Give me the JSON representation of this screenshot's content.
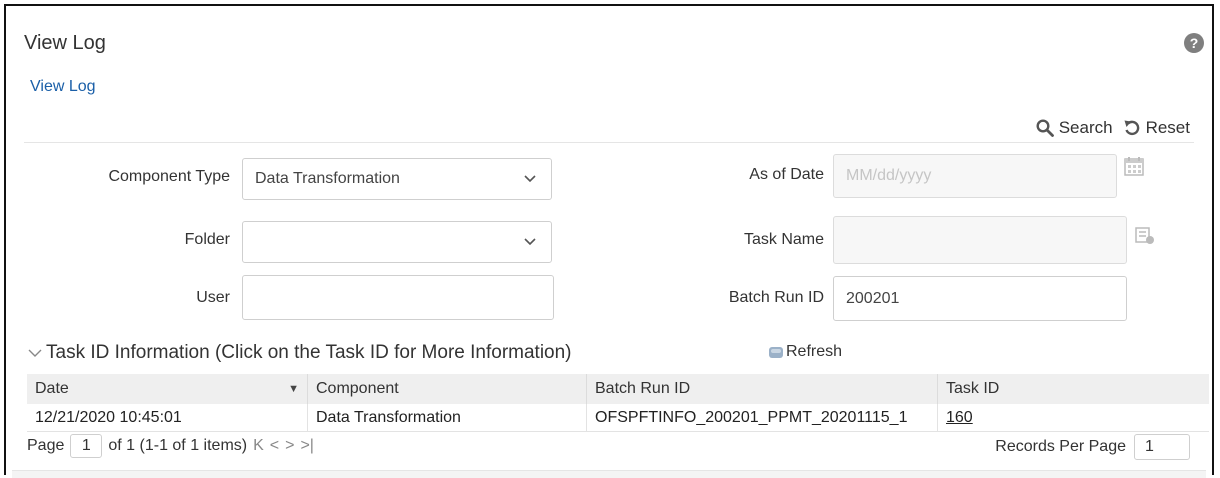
{
  "header": {
    "title": "View Log",
    "help_icon": "?"
  },
  "breadcrumb": {
    "link": "View Log"
  },
  "toolbar": {
    "search_label": "Search",
    "reset_label": "Reset"
  },
  "form": {
    "component_type": {
      "label": "Component Type",
      "value": "Data Transformation"
    },
    "folder": {
      "label": "Folder",
      "value": ""
    },
    "user": {
      "label": "User",
      "value": ""
    },
    "as_of_date": {
      "label": "As of Date",
      "placeholder": "MM/dd/yyyy"
    },
    "task_name": {
      "label": "Task Name",
      "value": ""
    },
    "batch_run_id": {
      "label": "Batch Run ID",
      "value": "200201"
    }
  },
  "section": {
    "title": "Task ID Information (Click on the Task ID for More Information)",
    "refresh_label": "Refresh"
  },
  "table": {
    "headers": [
      "Date",
      "Component",
      "Batch Run ID",
      "Task ID"
    ],
    "rows": [
      [
        "12/21/2020 10:45:01",
        "Data Transformation",
        "OFSPFTINFO_200201_PPMT_20201115_1",
        "160"
      ]
    ]
  },
  "pager": {
    "page_label": "Page",
    "page_value": "1",
    "page_info": "of 1 (1-1 of 1 items)",
    "records_label": "Records Per Page",
    "records_value": "1"
  },
  "colors": {
    "link": "#1a5fa8",
    "header_bg": "#efefef",
    "border": "#cfcfcf"
  }
}
